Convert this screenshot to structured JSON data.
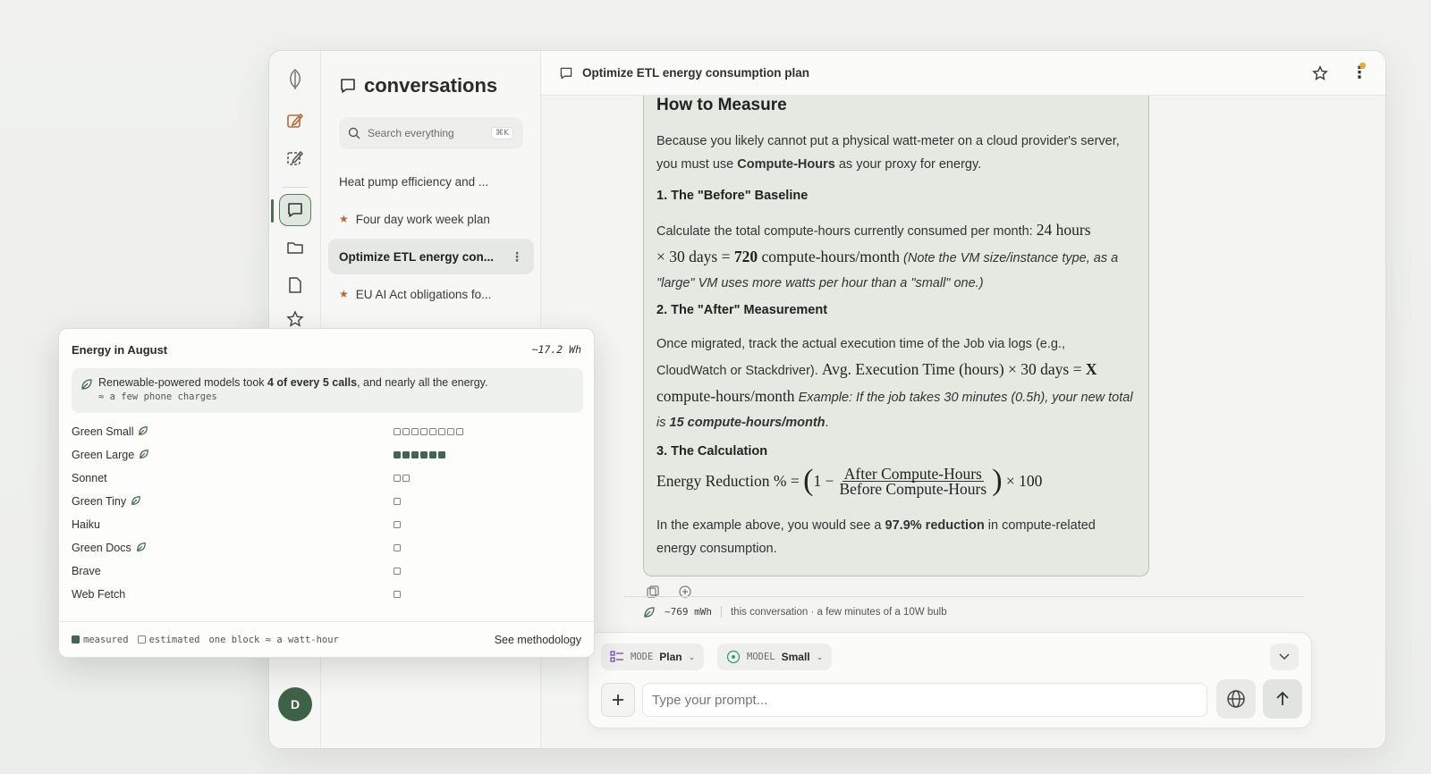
{
  "window": {
    "conversations_title": "conversations",
    "search_placeholder": "Search everything",
    "search_shortcut": "⌘K",
    "conversations": [
      {
        "label": "Heat pump efficiency and ...",
        "starred": false,
        "active": false
      },
      {
        "label": "Four day work week plan",
        "starred": true,
        "active": false
      },
      {
        "label": "Optimize ETL energy con...",
        "starred": false,
        "active": true
      },
      {
        "label": "EU AI Act obligations fo...",
        "starred": true,
        "active": false
      }
    ],
    "avatar_initial": "D"
  },
  "topbar": {
    "title": "Optimize ETL energy consumption plan"
  },
  "answer": {
    "heading": "How to Measure",
    "intro_pre": "Because you likely cannot put a physical watt-meter on a cloud provider's server, you must use ",
    "intro_bold": "Compute-Hours",
    "intro_post": " as your proxy for energy.",
    "s1_title": "1. The \"Before\" Baseline",
    "s1_text": "Calculate the total compute-hours currently consumed per month: ",
    "s1_math_a": "24 hours",
    "s1_math_b": "× 30 days = ",
    "s1_math_c": "720",
    "s1_math_d": " compute-hours/month",
    "s1_note": " (Note the VM size/instance type, as a \"large\" VM uses more watts per hour than a \"small\" one.)",
    "s2_title": "2. The \"After\" Measurement",
    "s2_text": "Once migrated, track the actual execution time of the Job via logs (e.g., CloudWatch or Stackdriver). ",
    "s2_math_a": "Avg. Execution Time (hours) × 30 days = ",
    "s2_math_b": "X",
    "s2_math_c": " compute-hours/month",
    "s2_note": " Example: If the job takes 30 minutes (0.5h), your new total is ",
    "s2_note_bold": "15 compute-hours/month",
    "s2_note_end": ".",
    "s3_title": "3. The Calculation",
    "s3_lhs": "Energy Reduction % = ",
    "s3_open": "(",
    "s3_one": "1 −",
    "s3_num": "After Compute-Hours",
    "s3_den": "Before Compute-Hours",
    "s3_close": ")",
    "s3_rhs": "× 100",
    "outro_pre": "In the example above, you would see a ",
    "outro_bold": "97.9% reduction",
    "outro_post": " in compute-related energy consumption."
  },
  "energy_line": {
    "value": "~769 mWh",
    "desc": "this conversation · a few minutes of a 10W bulb"
  },
  "composer": {
    "mode_label": "MODE",
    "mode_value": "Plan",
    "model_label": "MODEL",
    "model_value": "Small",
    "prompt_placeholder": "Type your prompt..."
  },
  "popup": {
    "title": "Energy in August",
    "total": "~17.2 Wh",
    "callout_pre": "Renewable-powered models took ",
    "callout_bold": "4 of every 5 calls",
    "callout_post": ", and nearly all the energy.",
    "callout_sub": "≈ a few phone charges",
    "rows": [
      {
        "name": "Green Small",
        "green": true,
        "blocks": 8,
        "kind": "estimated"
      },
      {
        "name": "Green Large",
        "green": true,
        "blocks": 6,
        "kind": "measured"
      },
      {
        "name": "Sonnet",
        "green": false,
        "blocks": 2,
        "kind": "estimated"
      },
      {
        "name": "Green Tiny",
        "green": true,
        "blocks": 1,
        "kind": "estimated"
      },
      {
        "name": "Haiku",
        "green": false,
        "blocks": 1,
        "kind": "estimated"
      },
      {
        "name": "Green Docs",
        "green": true,
        "blocks": 1,
        "kind": "estimated"
      },
      {
        "name": "Brave",
        "green": false,
        "blocks": 1,
        "kind": "estimated"
      },
      {
        "name": "Web Fetch",
        "green": false,
        "blocks": 1,
        "kind": "estimated"
      }
    ],
    "legend_measured": "measured",
    "legend_estimated": "estimated",
    "legend_unit": "one block ≈ a watt-hour",
    "methodology": "See methodology"
  },
  "colors": {
    "accent": "#44664c",
    "card_bg": "#e4e9e2",
    "star": "#b36a3a",
    "notif": "#e7a640"
  }
}
